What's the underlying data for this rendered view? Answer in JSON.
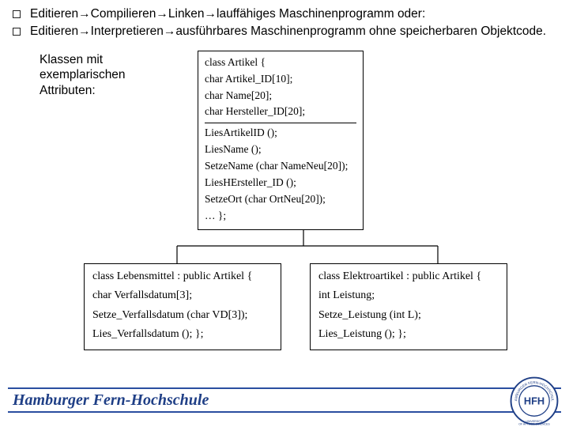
{
  "bullets": [
    "Editieren→Compilieren→Linken→lauffähiges Maschinenprogramm oder:",
    "Editieren→Interpretieren→ausführbares Maschinenprogramm ohne speicherbaren Objektcode."
  ],
  "section_label": "Klassen mit exemplarischen Attributen:",
  "class_main": {
    "header": "class Artikel {",
    "attrs": [
      "char Artikel_ID[10];",
      "char Name[20];",
      "char Hersteller_ID[20];"
    ],
    "methods": [
      "LiesArtikelID ();",
      "LiesName ();",
      "SetzeName (char NameNeu[20]);",
      "LiesHErsteller_ID ();",
      "SetzeOrt (char OrtNeu[20]);",
      "… };"
    ]
  },
  "class_left": {
    "lines": [
      "class Lebensmittel : public Artikel {",
      "char Verfallsdatum[3];",
      "Setze_Verfallsdatum (char VD[3]);",
      "Lies_Verfallsdatum (); };"
    ]
  },
  "class_right": {
    "lines": [
      "class Elektroartikel : public Artikel {",
      "int Leistung;",
      "Setze_Leistung (int L);",
      "Lies_Leistung (); };"
    ]
  },
  "footer": {
    "title": "Hamburger Fern-Hochschule",
    "logo_top": "HAMBURGER",
    "logo_mid": "HFH",
    "logo_sub": "UNIVERSITY OF APPLIED SCIENCES"
  }
}
